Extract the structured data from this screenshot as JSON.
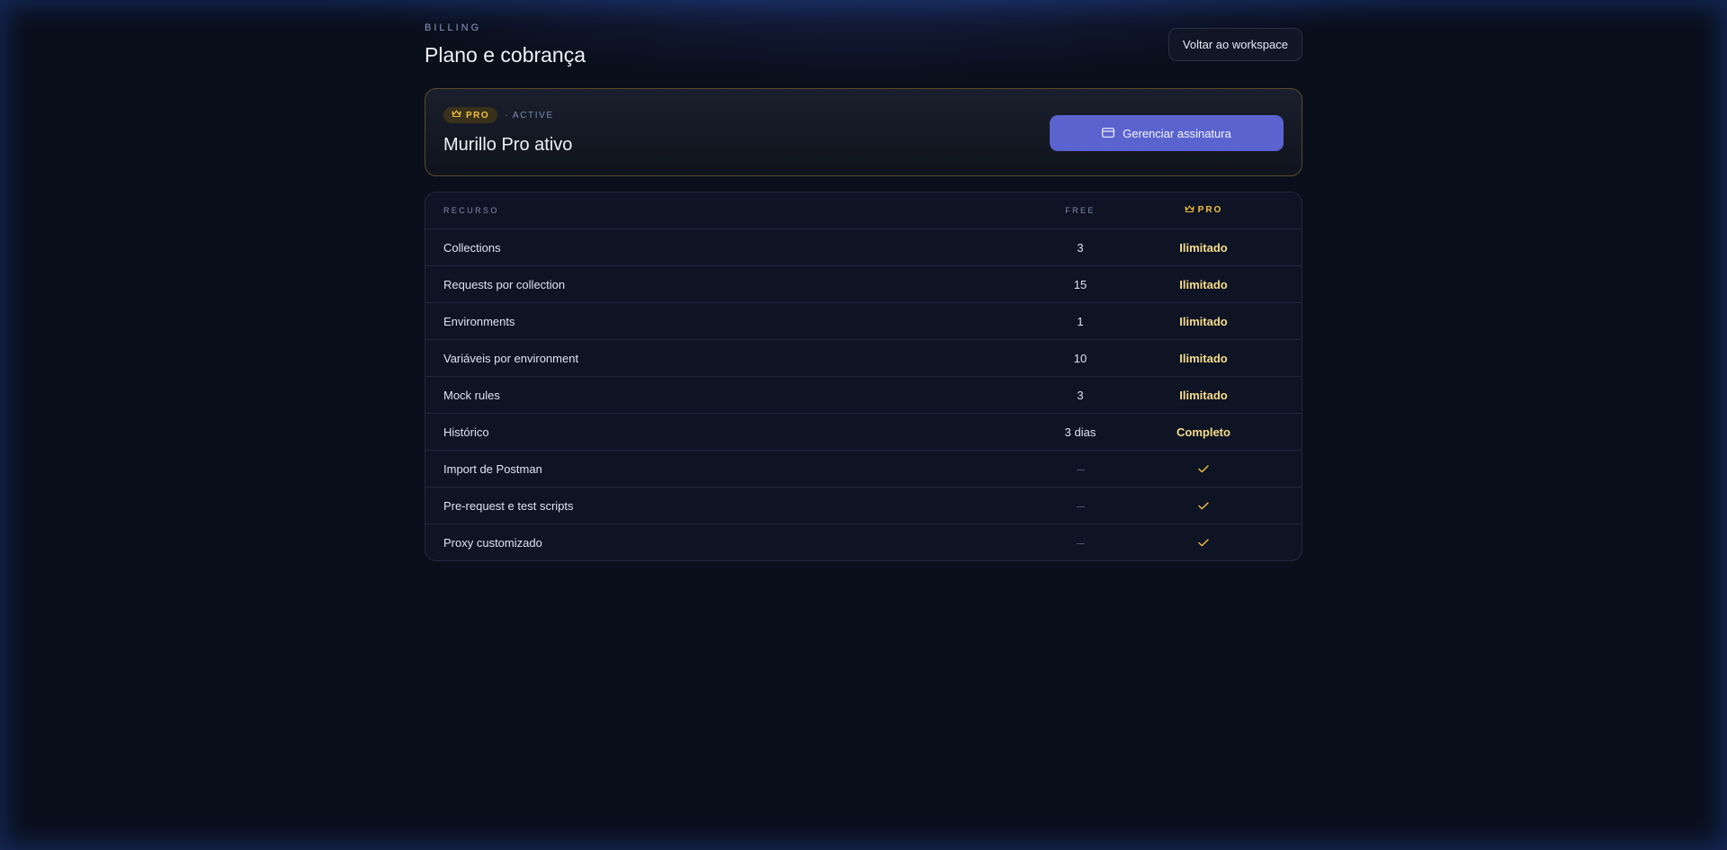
{
  "header": {
    "eyebrow": "BILLING",
    "title": "Plano e cobrança",
    "back_label": "Voltar ao workspace"
  },
  "plan": {
    "badge_label": "PRO",
    "badge_icon": "crown-icon",
    "status": "· ACTIVE",
    "name": "Murillo Pro ativo",
    "manage_label": "Gerenciar assinatura",
    "manage_icon": "credit-card-icon"
  },
  "colors": {
    "accent": "#5b63cf",
    "gold": "#f2c040",
    "gold_text": "#f5dc8a",
    "background": "#0a0f1c"
  },
  "table": {
    "headers": {
      "feature": "RECURSO",
      "free": "FREE",
      "pro": "PRO"
    },
    "rows": [
      {
        "feature": "Collections",
        "free": "3",
        "pro": "Ilimitado"
      },
      {
        "feature": "Requests por collection",
        "free": "15",
        "pro": "Ilimitado"
      },
      {
        "feature": "Environments",
        "free": "1",
        "pro": "Ilimitado"
      },
      {
        "feature": "Variáveis por environment",
        "free": "10",
        "pro": "Ilimitado"
      },
      {
        "feature": "Mock rules",
        "free": "3",
        "pro": "Ilimitado"
      },
      {
        "feature": "Histórico",
        "free": "3 dias",
        "pro": "Completo"
      },
      {
        "feature": "Import de Postman",
        "free": "dash-icon",
        "pro": "check-icon"
      },
      {
        "feature": "Pre-request e test scripts",
        "free": "dash-icon",
        "pro": "check-icon"
      },
      {
        "feature": "Proxy customizado",
        "free": "dash-icon",
        "pro": "check-icon"
      }
    ]
  }
}
